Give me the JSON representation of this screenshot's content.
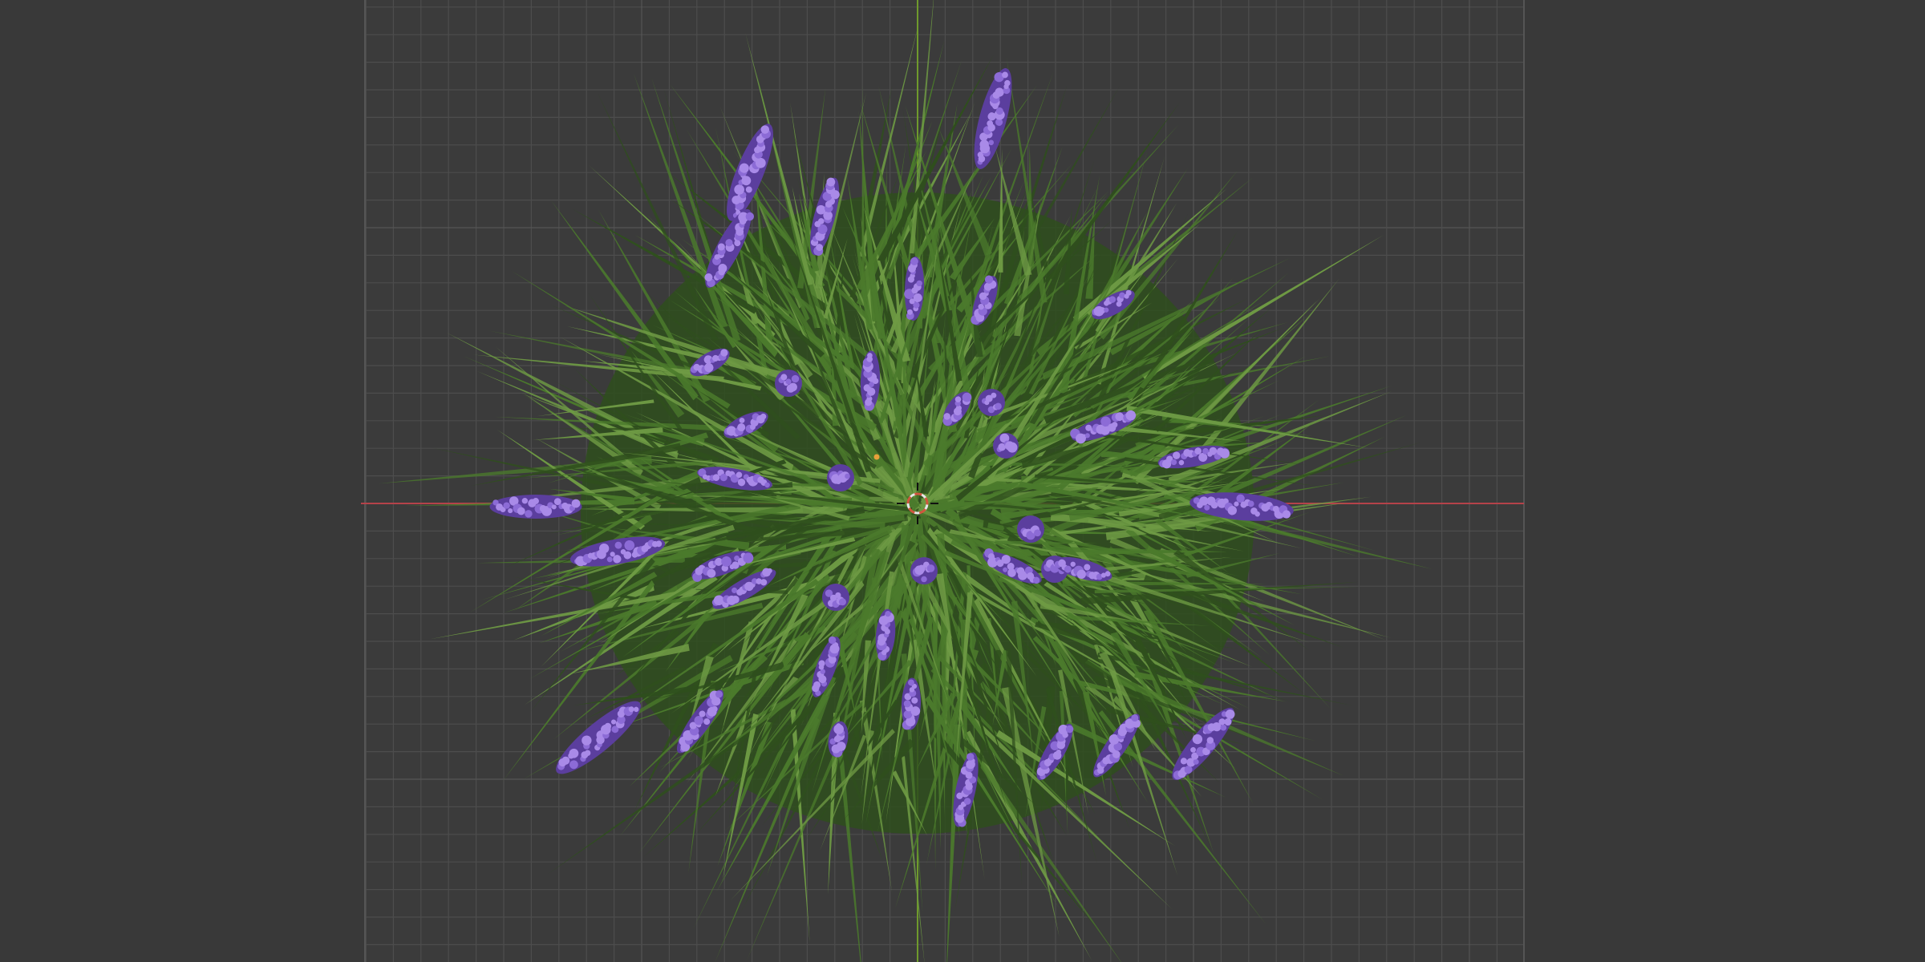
{
  "viewport": {
    "view": "top-orthographic",
    "grid": true,
    "colors": {
      "background": "#393939",
      "grid_plane_fill": "#3b3b3b",
      "grid_line": "#4d4d4d",
      "grid_major_line": "#555555",
      "x_axis": "#b5424a",
      "y_axis": "#6f9a2c",
      "origin_marker": "#e8a13a",
      "cursor_primary": "#e7e7e7",
      "cursor_secondary": "#d0563e"
    }
  },
  "scene_object": {
    "type": "grass-clump-with-lavender-flowers",
    "colors": {
      "blade_dark": "#2f4f1d",
      "blade_mid": "#4b7a2c",
      "blade_light": "#6e9a44",
      "flower_light": "#a98ae8",
      "flower_mid": "#8c6bd6",
      "flower_dark": "#5b3e9e"
    },
    "flower_count": 37
  }
}
